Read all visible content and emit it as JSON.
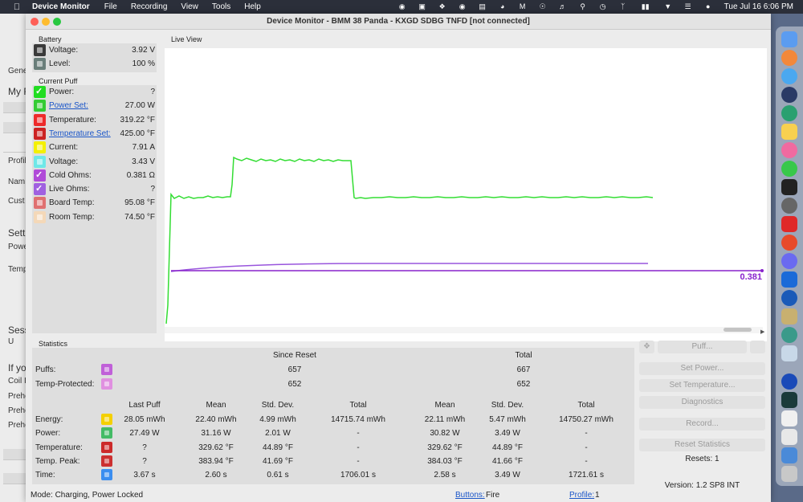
{
  "menubar": {
    "app_name": "Device Monitor",
    "items": [
      "File",
      "Recording",
      "View",
      "Tools",
      "Help"
    ],
    "clock": "Tue Jul 16  6:06 PM"
  },
  "window": {
    "title": "Device Monitor - BMM 38 Panda - KXGD SDBG TNFD [not connected]"
  },
  "background_window": {
    "labels": [
      "Gene",
      "My F",
      "Profil",
      "Nam",
      "Cust",
      "Sett",
      "Powe",
      "Temp",
      "Sess",
      "U",
      "If yo",
      "Coil I",
      "Prehe",
      "Prehe",
      "Prehe"
    ]
  },
  "battery": {
    "label": "Battery",
    "rows": [
      {
        "label": "Voltage:",
        "value": "3.92 V",
        "color": "#3a3a3a"
      },
      {
        "label": "Level:",
        "value": "100 %",
        "color": "#6a7e7a"
      }
    ]
  },
  "current_puff": {
    "label": "Current Puff",
    "rows": [
      {
        "label": "Power:",
        "value": "?",
        "color": "#22dd22",
        "checked": true,
        "link": false
      },
      {
        "label": "Power Set:",
        "value": "27.00 W",
        "color": "#33cc33",
        "checked": false,
        "link": true
      },
      {
        "label": "Temperature:",
        "value": "319.22 °F",
        "color": "#ee2a2a",
        "checked": false,
        "link": false
      },
      {
        "label": "Temperature Set:",
        "value": "425.00 °F",
        "color": "#cc2222",
        "checked": false,
        "link": true
      },
      {
        "label": "Current:",
        "value": "7.91 A",
        "color": "#f4f000",
        "checked": false,
        "link": false
      },
      {
        "label": "Voltage:",
        "value": "3.43 V",
        "color": "#6ee8e8",
        "checked": false,
        "link": false
      },
      {
        "label": "Cold Ohms:",
        "value": "0.381 Ω",
        "color": "#b04ad8",
        "checked": true,
        "link": false
      },
      {
        "label": "Live Ohms:",
        "value": "?",
        "color": "#a060e0",
        "checked": true,
        "link": false
      },
      {
        "label": "Board Temp:",
        "value": "95.08 °F",
        "color": "#e07070",
        "checked": false,
        "link": false
      },
      {
        "label": "Room Temp:",
        "value": "74.50 °F",
        "color": "#f4d8b8",
        "checked": false,
        "link": false
      }
    ]
  },
  "live_view": {
    "label": "Live View",
    "value_label": "0.381",
    "power_color": "#33dd33",
    "ohms_color": "#8822cc",
    "live_ohms_color": "#9955dd"
  },
  "statistics": {
    "label": "Statistics",
    "since_reset": "Since Reset",
    "total": "Total",
    "puffs": {
      "label": "Puffs:",
      "since": "657",
      "total": "667",
      "color": "#c060d8"
    },
    "temp_protected": {
      "label": "Temp-Protected:",
      "since": "652",
      "total": "652",
      "color": "#e090e0"
    },
    "columns": [
      "Last Puff",
      "Mean",
      "Std. Dev.",
      "Total",
      "Mean",
      "Std. Dev.",
      "Total"
    ],
    "rows": [
      {
        "label": "Energy:",
        "color": "#f4d000",
        "values": [
          "28.05 mWh",
          "22.40 mWh",
          "4.99 mWh",
          "14715.74 mWh",
          "22.11 mWh",
          "5.47 mWh",
          "14750.27 mWh"
        ]
      },
      {
        "label": "Power:",
        "color": "#44bb66",
        "values": [
          "27.49 W",
          "31.16 W",
          "2.01 W",
          "-",
          "30.82 W",
          "3.49 W",
          "-"
        ]
      },
      {
        "label": "Temperature:",
        "color": "#cc2a2a",
        "values": [
          "?",
          "329.62 °F",
          "44.89 °F",
          "-",
          "329.62 °F",
          "44.89 °F",
          "-"
        ]
      },
      {
        "label": "Temp. Peak:",
        "color": "#cc3030",
        "values": [
          "?",
          "383.94 °F",
          "41.69 °F",
          "-",
          "384.03 °F",
          "41.66 °F",
          "-"
        ]
      },
      {
        "label": "Time:",
        "color": "#3b8ef0",
        "values": [
          "3.67 s",
          "2.60 s",
          "0.61 s",
          "1706.01 s",
          "2.58 s",
          "3.49 W",
          "1721.61 s"
        ]
      }
    ]
  },
  "buttons": {
    "puff": "Puff...",
    "set_power": "Set Power...",
    "set_temperature": "Set Temperature...",
    "diagnostics": "Diagnostics",
    "record": "Record...",
    "reset_statistics": "Reset Statistics",
    "resets": "Resets: 1",
    "version": "Version: 1.2 SP8 INT"
  },
  "statusbar": {
    "mode": "Mode: Charging, Power Locked",
    "buttons_label": "Buttons:",
    "buttons_value": "Fire",
    "profile_label": "Profile:",
    "profile_value": "1"
  }
}
